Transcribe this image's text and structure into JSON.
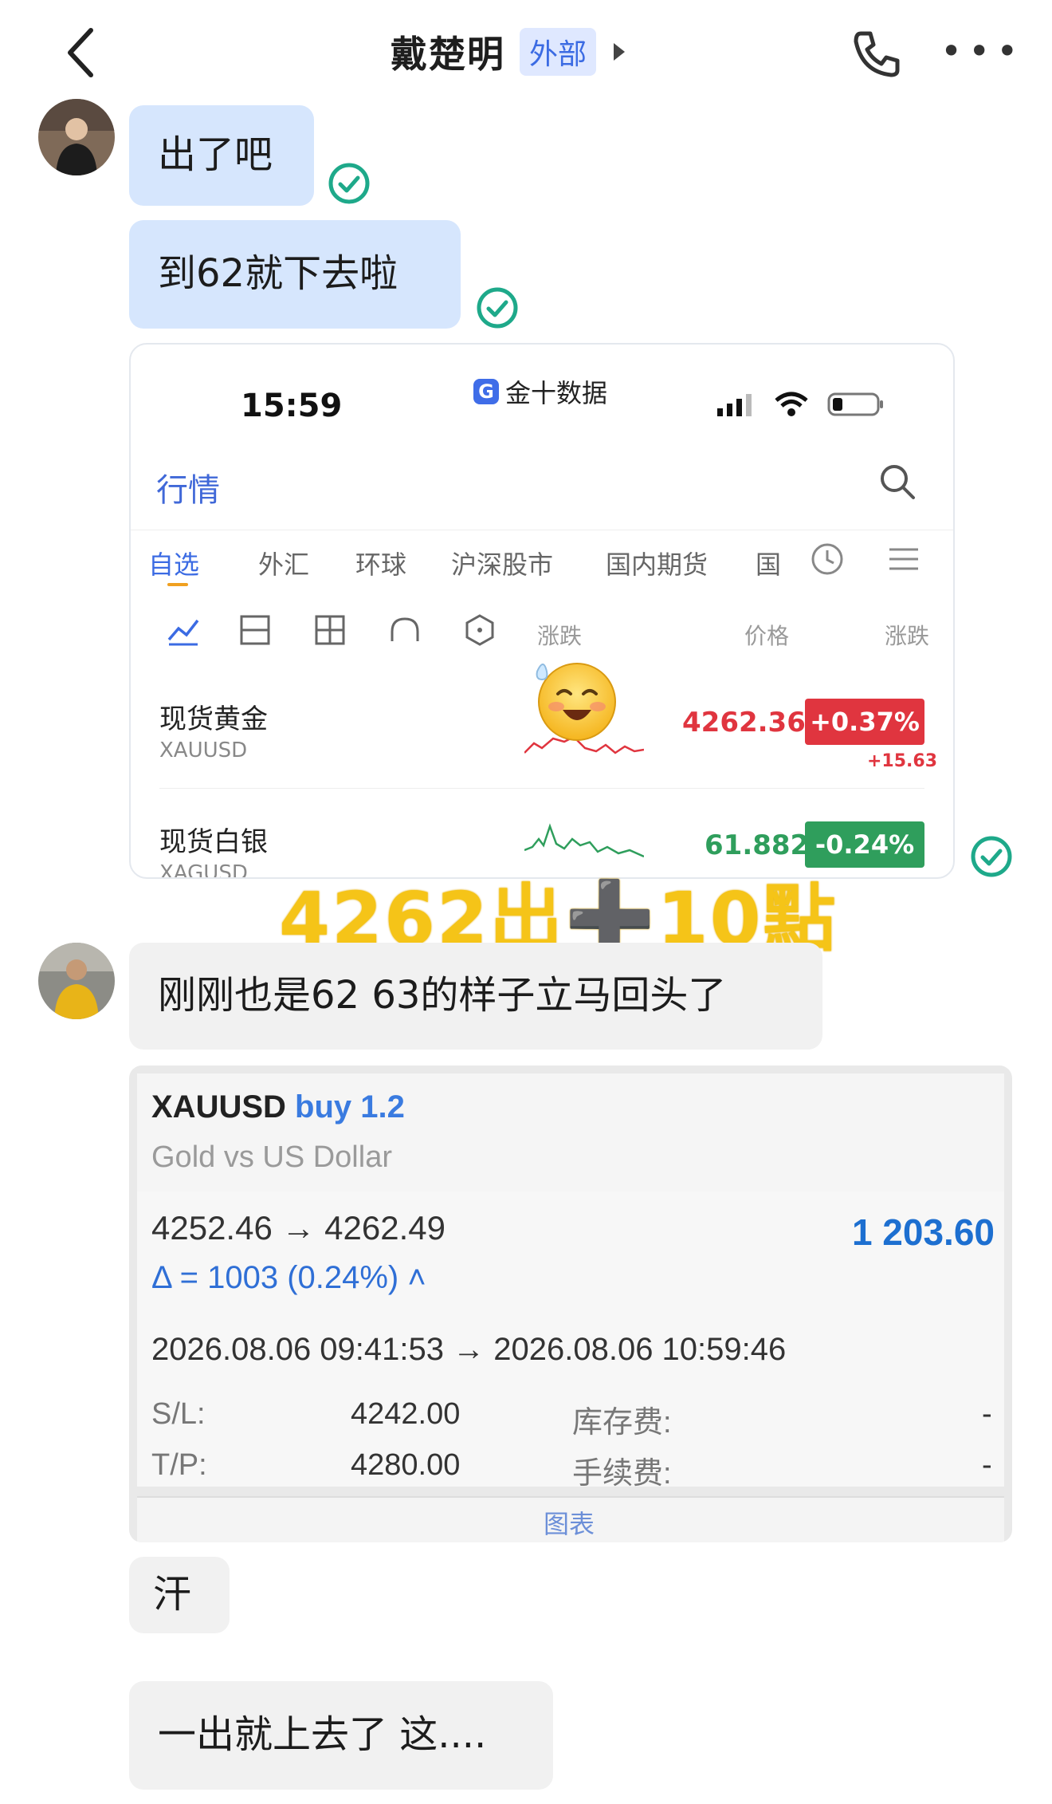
{
  "header": {
    "title": "戴楚明",
    "tag": "外部",
    "back_icon": "chevron-left-icon",
    "call_icon": "phone-icon",
    "more_icon": "more-dots-icon",
    "more_text": "•••"
  },
  "messages": {
    "m1": "出了吧",
    "m2": "到62就下去啦",
    "m3": "刚刚也是62 63的样子立马回头了",
    "m4": "汗",
    "m5": "一出就上去了 这...."
  },
  "screenshot1": {
    "status_time": "15:59",
    "app_name": "金十数据",
    "app_icon_letter": "G",
    "section_title": "行情",
    "tabs": [
      "自选",
      "外汇",
      "环球",
      "沪深股市",
      "国内期货",
      "国"
    ],
    "columns": [
      "涨跌",
      "价格",
      "涨跌"
    ],
    "quotes": [
      {
        "name": "现货黄金",
        "code": "XAUUSD",
        "price": "4262.36",
        "change_pct": "+0.37%",
        "change_abs": "+15.63",
        "color": "#e0353f"
      },
      {
        "name": "现货白银",
        "code": "XAGUSD",
        "price": "61.882",
        "change_pct": "-0.24%",
        "change_abs": "",
        "color": "#2f9e5c"
      }
    ]
  },
  "overlay": {
    "caption_left": "4262出",
    "caption_plus": "➕",
    "caption_right": "10點"
  },
  "screenshot2": {
    "symbol": "XAUUSD",
    "side": "buy 1.2",
    "description": "Gold vs US Dollar",
    "prices": "4252.46 → 4262.49",
    "profit": "1 203.60",
    "delta": "Δ = 1003 (0.24%) ˄",
    "times": "2026.08.06 09:41:53 → 2026.08.06 10:59:46",
    "sl_label": "S/L:",
    "sl_value": "4242.00",
    "tp_label": "T/P:",
    "tp_value": "4280.00",
    "swap_label": "库存费:",
    "swap_value": "-",
    "fee_label": "手续费:",
    "fee_value": "-",
    "bottom_label": "图表"
  },
  "colors": {
    "accent_blue": "#3b6be3",
    "check_green": "#1ea98a",
    "bubble_blue": "#d6e6fd",
    "bubble_gray": "#f1f1f1",
    "caption_yellow": "#f5c418"
  }
}
